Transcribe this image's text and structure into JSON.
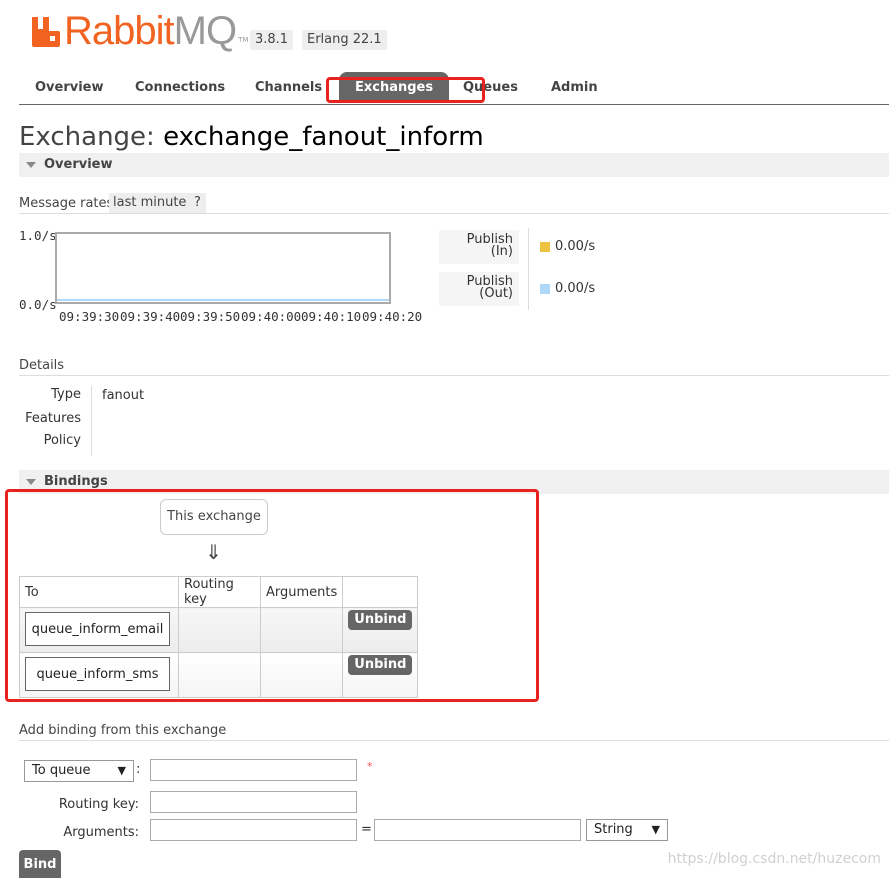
{
  "header": {
    "brand_a": "Rabbit",
    "brand_b": "MQ",
    "tm": "TM",
    "version": "3.8.1",
    "erlang": "Erlang 22.1"
  },
  "nav": {
    "items": [
      "Overview",
      "Connections",
      "Channels",
      "Exchanges",
      "Queues",
      "Admin"
    ],
    "active": "Exchanges"
  },
  "page": {
    "title_prefix": "Exchange:",
    "exchange_name": "exchange_fanout_inform"
  },
  "overview": {
    "section_label": "Overview",
    "message_rates_label": "Message rates",
    "range": "last minute",
    "help": "?",
    "y_max": "1.0/s",
    "y_min": "0.0/s",
    "x_ticks": [
      "09:39:30",
      "09:39:40",
      "09:39:50",
      "09:40:00",
      "09:40:10",
      "09:40:20"
    ],
    "legend": [
      {
        "line1": "Publish",
        "line2": "(In)",
        "value": "0.00/s",
        "color": "#edc240"
      },
      {
        "line1": "Publish",
        "line2": "(Out)",
        "value": "0.00/s",
        "color": "#afd8f8"
      }
    ]
  },
  "details": {
    "label": "Details",
    "type_key": "Type",
    "type_value": "fanout",
    "features_key": "Features",
    "policy_key": "Policy"
  },
  "bindings": {
    "section_label": "Bindings",
    "this_exchange": "This exchange",
    "arrow": "⇓",
    "columns": [
      "To",
      "Routing key",
      "Arguments"
    ],
    "rows": [
      {
        "to": "queue_inform_email",
        "action": "Unbind"
      },
      {
        "to": "queue_inform_sms",
        "action": "Unbind"
      }
    ]
  },
  "add_binding": {
    "label": "Add binding from this exchange",
    "destination_select": "To queue",
    "colon": ":",
    "required_mark": "*",
    "routing_key_label": "Routing key:",
    "arguments_label": "Arguments:",
    "equals": "=",
    "type_select": "String",
    "bind_button": "Bind"
  },
  "watermark": "https://blog.csdn.net/huzecom"
}
